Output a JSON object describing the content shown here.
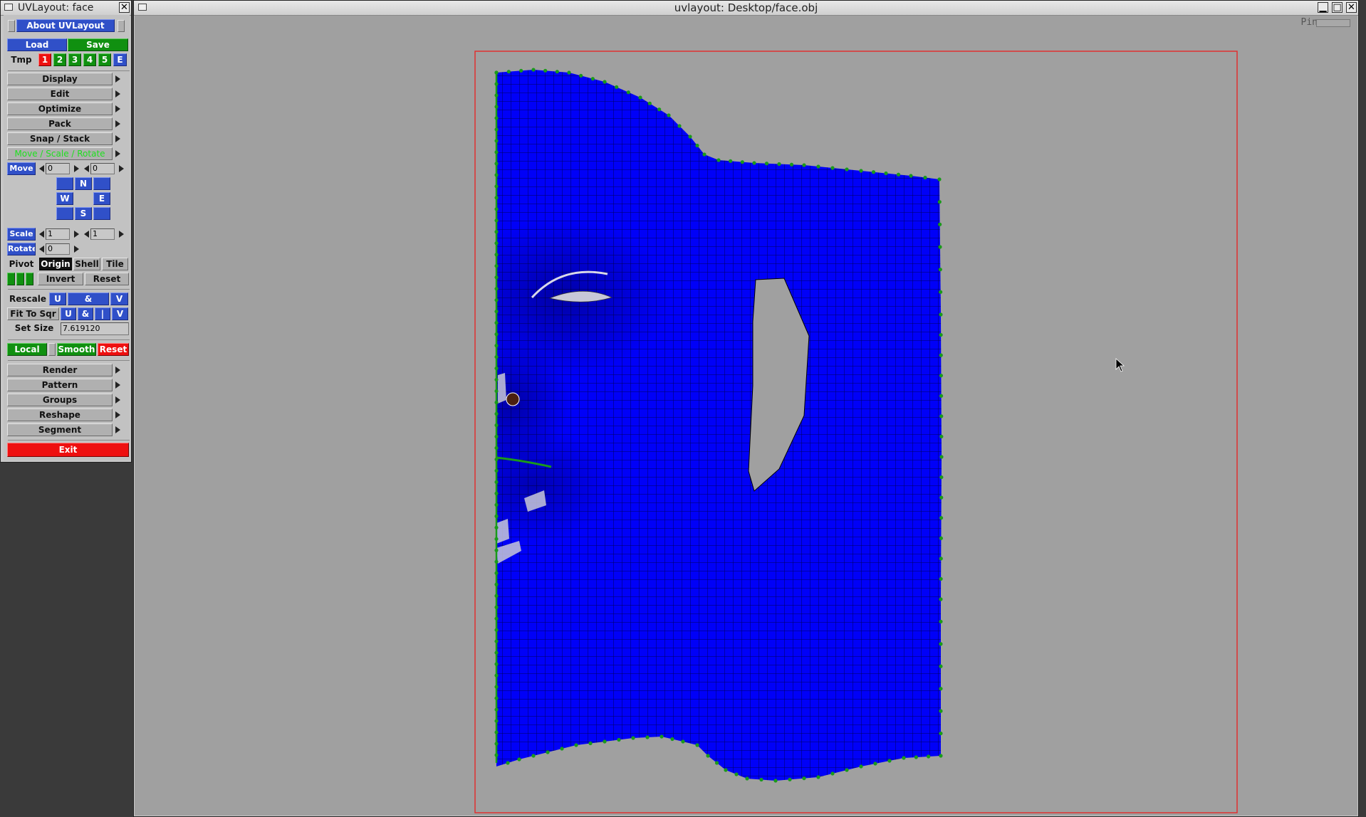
{
  "panel": {
    "title": "UVLayout: face",
    "about": "About UVLayout",
    "load": "Load",
    "save": "Save",
    "tmp": {
      "label": "Tmp",
      "slots": [
        "1",
        "2",
        "3",
        "4",
        "5",
        "E"
      ]
    },
    "menus_top": [
      "Display",
      "Edit",
      "Optimize",
      "Pack",
      "Snap / Stack",
      "Move / Scale / Rotate"
    ],
    "move": {
      "label": "Move",
      "x": "0",
      "y": "0",
      "n": "N",
      "w": "W",
      "e": "E",
      "s": "S"
    },
    "scale": {
      "label": "Scale",
      "x": "1",
      "y": "1"
    },
    "rotate": {
      "label": "Rotate",
      "value": "0"
    },
    "pivot": {
      "label": "Pivot",
      "origin": "Origin",
      "shell": "Shell",
      "tile": "Tile"
    },
    "invert": "Invert",
    "reset": "Reset",
    "rescale": {
      "label": "Rescale",
      "u": "U",
      "and": "&",
      "v": "V"
    },
    "fit": {
      "label": "Fit To Sqr",
      "u": "U",
      "and": "&",
      "bar": "|",
      "v": "V"
    },
    "setsize": {
      "label": "Set Size",
      "value": "7.619120"
    },
    "local": "Local",
    "smooth": "Smooth",
    "reset2": "Reset",
    "menus_bottom": [
      "Render",
      "Pattern",
      "Groups",
      "Reshape",
      "Segment"
    ],
    "exit": "Exit"
  },
  "viewport": {
    "title": "uvlayout: Desktop/face.obj",
    "pin_label": "Pin"
  },
  "colors": {
    "mesh": "#0000f8",
    "edge_points": "#1a9a1a",
    "tile_border": "#e03030",
    "background": "#a0a0a0"
  }
}
